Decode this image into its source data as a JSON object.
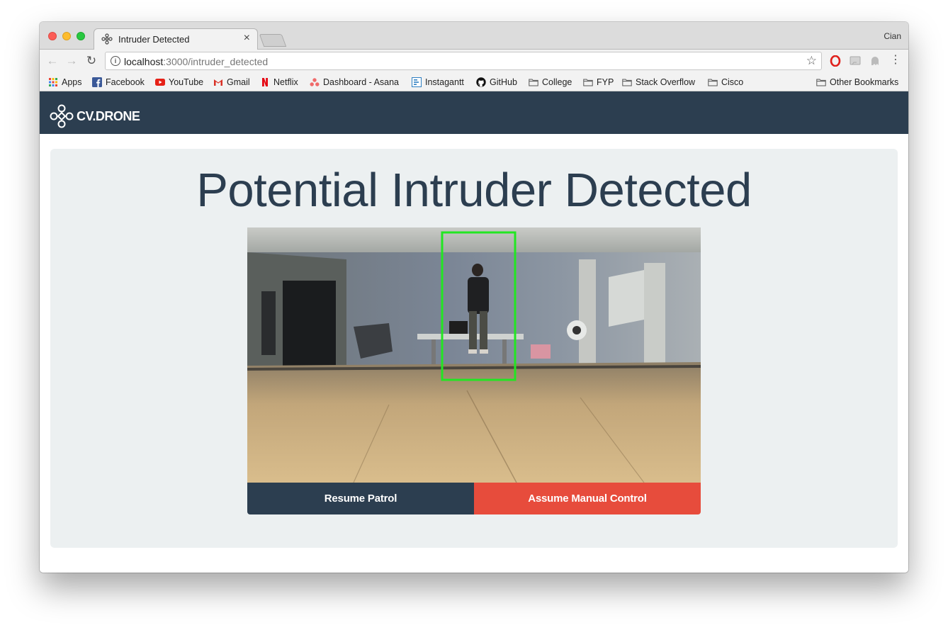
{
  "browser": {
    "tab_title": "Intruder Detected",
    "tab_close_glyph": "×",
    "profile_name": "Cian",
    "url_host": "localhost",
    "url_path": ":3000/intruder_detected",
    "icons": {
      "back": "arrow-left-icon",
      "forward": "arrow-right-icon",
      "reload": "reload-icon",
      "info": "info-icon",
      "bookmark_star": "star-icon",
      "menu": "kebab-menu-icon"
    }
  },
  "bookmarks": {
    "items": [
      {
        "label": "Apps",
        "icon": "apps-grid-icon"
      },
      {
        "label": "Facebook",
        "icon": "facebook-icon"
      },
      {
        "label": "YouTube",
        "icon": "youtube-icon"
      },
      {
        "label": "Gmail",
        "icon": "gmail-icon"
      },
      {
        "label": "Netflix",
        "icon": "netflix-icon"
      },
      {
        "label": "Dashboard - Asana",
        "icon": "asana-icon"
      },
      {
        "label": "Instagantt",
        "icon": "instagantt-icon"
      },
      {
        "label": "GitHub",
        "icon": "github-icon"
      },
      {
        "label": "College",
        "icon": "folder-icon"
      },
      {
        "label": "FYP",
        "icon": "folder-icon"
      },
      {
        "label": "Stack Overflow",
        "icon": "folder-icon"
      },
      {
        "label": "Cisco",
        "icon": "folder-icon"
      }
    ],
    "other": {
      "label": "Other Bookmarks",
      "icon": "folder-icon"
    }
  },
  "app": {
    "brand": "CV.DRONE",
    "headline": "Potential Intruder Detected",
    "buttons": {
      "resume": "Resume Patrol",
      "manual": "Assume Manual Control"
    },
    "colors": {
      "navbar": "#2c3e50",
      "panel": "#ecf0f1",
      "danger": "#e74c3c",
      "detection_box": "#22e622"
    }
  }
}
